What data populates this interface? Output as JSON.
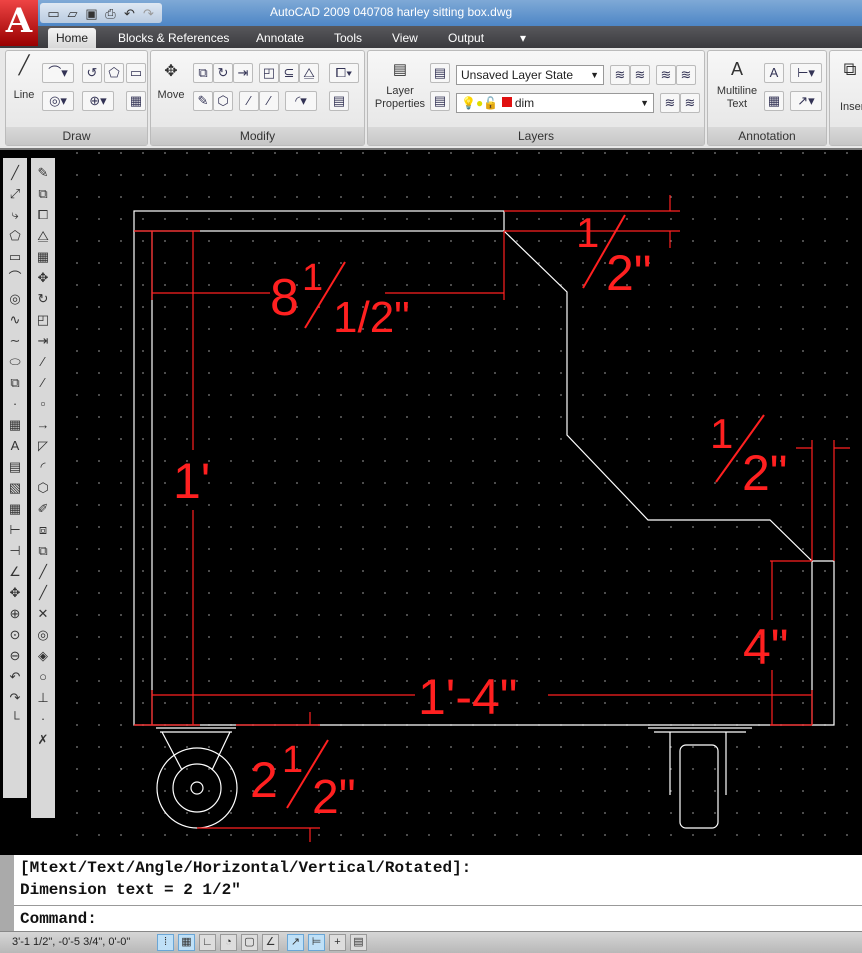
{
  "window": {
    "title": "AutoCAD 2009 040708 harley sitting box.dwg",
    "app_logo": "A"
  },
  "quick_access": [
    "new-icon",
    "open-icon",
    "save-icon",
    "print-icon",
    "undo-icon",
    "redo-icon"
  ],
  "tabs": [
    {
      "label": "Home",
      "active": true
    },
    {
      "label": "Blocks & References"
    },
    {
      "label": "Annotate"
    },
    {
      "label": "Tools"
    },
    {
      "label": "View"
    },
    {
      "label": "Output"
    }
  ],
  "ribbon": {
    "draw": {
      "title": "Draw",
      "line_label": "Line"
    },
    "modify": {
      "title": "Modify",
      "move_label": "Move"
    },
    "layers": {
      "title": "Layers",
      "layer_properties_label": "Layer Properties",
      "layer_state": "Unsaved Layer State",
      "current_layer": "dim",
      "layer_color": "#e01010"
    },
    "annotation": {
      "title": "Annotation",
      "multiline_text_label": "Multiline Text"
    },
    "insert": {
      "label": "Inser"
    }
  },
  "drawing": {
    "dims": {
      "top_width": "8",
      "top_width_frac": "1/2\"",
      "top_thickness_num": "1",
      "top_thickness_den": "2\"",
      "height": "1'",
      "right_thick_num": "1",
      "right_thick_den": "2\"",
      "right_height": "4\"",
      "total_width": "1'-4\"",
      "caster_whole": "2",
      "caster_num": "1",
      "caster_den": "2\""
    },
    "dim_color": "#ff2020",
    "line_color": "#ffffff"
  },
  "command": {
    "line1": "[Mtext/Text/Angle/Horizontal/Vertical/Rotated]:",
    "line2": "Dimension text = 2 1/2\"",
    "prompt": "Command:"
  },
  "status": {
    "coordinates": "3'-1 1/2\", -0'-5 3/4\", 0'-0\""
  }
}
